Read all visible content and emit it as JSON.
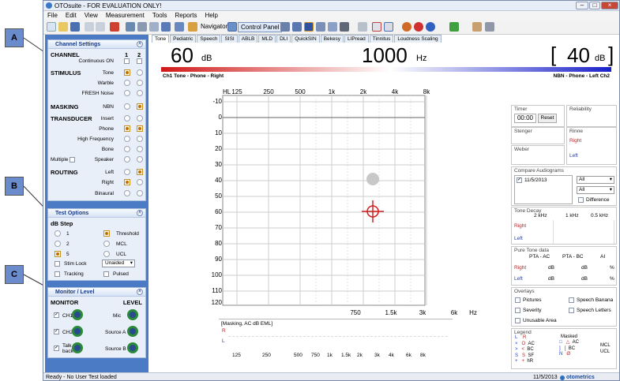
{
  "title": "OTOsuite - FOR EVALUATION ONLY!",
  "menu": [
    "File",
    "Edit",
    "View",
    "Measurement",
    "Tools",
    "Reports",
    "Help"
  ],
  "toolbar": {
    "navigator": "Navigator",
    "control_panel": "Control Panel"
  },
  "callouts": {
    "a": "A",
    "b": "B",
    "c": "C"
  },
  "channel_settings": {
    "title": "Channel Settings",
    "channel": "CHANNEL",
    "col1": "1",
    "col2": "2",
    "continuous": "Continuous ON",
    "stimulus": "STIMULUS",
    "tone": "Tone",
    "warble": "Warble",
    "fresh_noise": "FRESH Noise",
    "masking": "MASKING",
    "nbn": "NBN",
    "transducer": "TRANSDUCER",
    "insert": "Insert",
    "phone": "Phone",
    "high_freq": "High Frequency",
    "bone": "Bone",
    "multiple": "Multiple",
    "speaker": "Speaker",
    "routing": "ROUTING",
    "left": "Left",
    "right": "Right",
    "binaural": "Binaural"
  },
  "test_options": {
    "title": "Test Options",
    "db_step": "dB Step",
    "s1": "1",
    "s2": "2",
    "s5": "5",
    "threshold": "Threshold",
    "mcl": "MCL",
    "ucl": "UCL",
    "stim_lock": "Stim Lock",
    "unaided": "Unaided",
    "tracking": "Tracking",
    "pulsed": "Pulsed"
  },
  "monitor": {
    "title": "Monitor / Level",
    "monitor": "MONITOR",
    "level": "LEVEL",
    "ch1": "CH1",
    "ch2": "CH2",
    "talk": "Talk",
    "back": "back",
    "mic": "Mic",
    "source_a": "Source A",
    "source_b": "Source B"
  },
  "tabs": [
    "Tone",
    "Pediatric",
    "Speech",
    "SISI",
    "ABLB",
    "MLD",
    "DLI",
    "QuickSIN",
    "Bekesy",
    "LIPread",
    "Tinnitus",
    "Loudness Scaling"
  ],
  "level_display": {
    "left_val": "60",
    "left_unit": "dB",
    "freq": "1000",
    "freq_unit": "Hz",
    "right_open": "[",
    "right_val": "40",
    "right_unit": "dB",
    "right_close": "]",
    "ch1_label": "Ch1  Tone - Phone - Right",
    "ch2_label": "NBN - Phone - Left  Ch2"
  },
  "audiogram": {
    "hl": "HL",
    "top_freqs": [
      "125",
      "250",
      "500",
      "1k",
      "2k",
      "4k",
      "8k"
    ],
    "bottom_freqs": [
      "750",
      "1.5k",
      "3k",
      "6k"
    ],
    "hz": "Hz",
    "levels": [
      "-10",
      "0",
      "10",
      "20",
      "30",
      "40",
      "50",
      "60",
      "70",
      "80",
      "90",
      "100",
      "110",
      "120"
    ],
    "masking_label": "[Masking, AC dB EML]",
    "r": "R",
    "l": "L",
    "mask_freqs": [
      "125",
      "250",
      "500",
      "750",
      "1k",
      "1.5k",
      "2k",
      "3k",
      "4k",
      "6k",
      "8k"
    ]
  },
  "right_panel": {
    "timer": "Timer",
    "timer_val": "00:00",
    "reset": "Reset",
    "reliability": "Reliability",
    "stenger": "Stenger",
    "rinne": "Rinne",
    "right": "Right",
    "left": "Left",
    "weber": "Weber",
    "compare": "Compare Audiograms",
    "date": "11/5/2013",
    "all1": "All",
    "all2": "All",
    "difference": "Difference",
    "tone_decay": "Tone Decay",
    "td_cols": [
      "2 kHz",
      "1 kHz",
      "0.5 kHz"
    ],
    "pure_tone": "Pure Tone data",
    "pta_ac": "PTA - AC",
    "pta_bc": "PTA - BC",
    "ai": "AI",
    "db": "dB",
    "pct": "%",
    "overlays": "Overlays",
    "pictures": "Pictures",
    "speech_banana": "Speech Banana",
    "severity": "Severity",
    "speech_letters": "Speech Letters",
    "unusable": "Unusable Area",
    "legend": "Legend",
    "masked": "Masked",
    "legend_rows": [
      [
        "L",
        "R",
        "",
        "L",
        "R",
        ""
      ],
      [
        "×",
        "O",
        "AC",
        "□",
        "△",
        "AC"
      ],
      [
        ">",
        "<",
        "BC",
        "]",
        "[",
        "BC"
      ],
      [
        "S",
        "S",
        "SF",
        "N",
        "Ø",
        ""
      ],
      [
        "+",
        "+",
        "hR",
        "",
        "",
        ""
      ]
    ],
    "mcl": "MCL",
    "ucl": "UCL"
  },
  "status": {
    "left": "Ready - No User Test loaded",
    "date": "11/5/2013",
    "brand": "otometrics"
  },
  "colors": {
    "panel_blue": "#4a7bc4",
    "red": "#c02020",
    "blue": "#2040c0"
  }
}
